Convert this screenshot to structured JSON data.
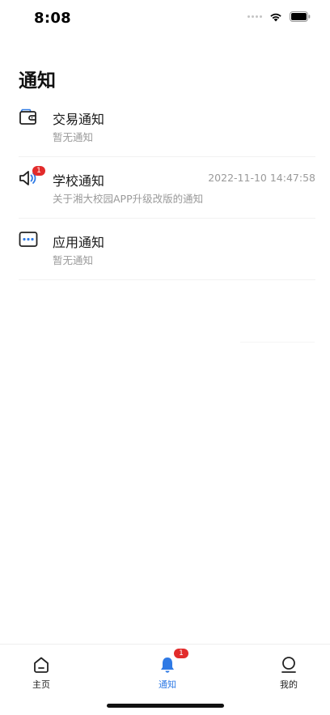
{
  "status_bar": {
    "time": "8:08"
  },
  "page": {
    "title": "通知"
  },
  "notices": [
    {
      "title": "交易通知",
      "subtitle": "暂无通知",
      "time": "",
      "badge": "",
      "icon": "wallet-icon"
    },
    {
      "title": "学校通知",
      "subtitle": "关于湘大校园APP升级改版的通知",
      "time": "2022-11-10 14:47:58",
      "badge": "1",
      "icon": "speaker-icon"
    },
    {
      "title": "应用通知",
      "subtitle": "暂无通知",
      "time": "",
      "badge": "",
      "icon": "chat-dots-icon"
    }
  ],
  "tab_bar": {
    "home_label": "主页",
    "notice_label": "通知",
    "notice_badge": "1",
    "mine_label": "我的",
    "active_color": "#2f7ae5"
  },
  "colors": {
    "badge": "#e22b2b",
    "accent": "#2f7ae5"
  }
}
